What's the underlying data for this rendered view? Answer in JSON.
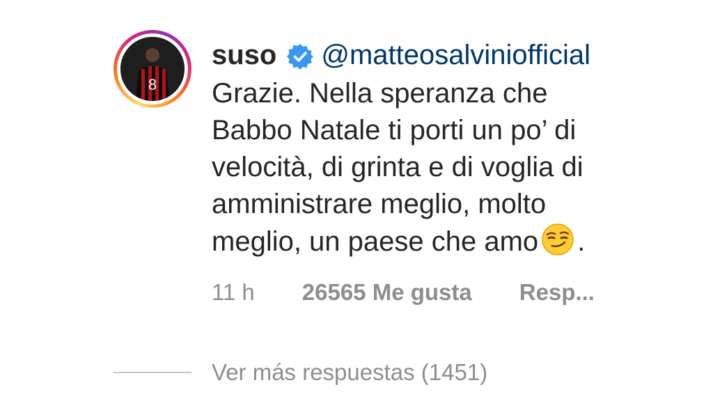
{
  "comment": {
    "username": "suso",
    "verified_icon": "verified-badge-icon",
    "mention": "@matteosalviniofficial",
    "text_lines": [
      "Grazie. Nella speranza che",
      "Babbo Natale ti porti un po’ di",
      "velocità, di grinta e di voglia di",
      "amministrare meglio, molto",
      "meglio, un paese che amo"
    ],
    "trailing_punctuation": ".",
    "emoji": "smirking-face-emoji",
    "time": "11 h",
    "likes": "26565 Me gusta",
    "reply": "Resp..."
  },
  "replies": {
    "more_label": "Ver más respuestas (1451)"
  },
  "colors": {
    "text": "#262626",
    "mention": "#00376b",
    "meta": "#8e8e8e",
    "verified": "#3897f0"
  }
}
